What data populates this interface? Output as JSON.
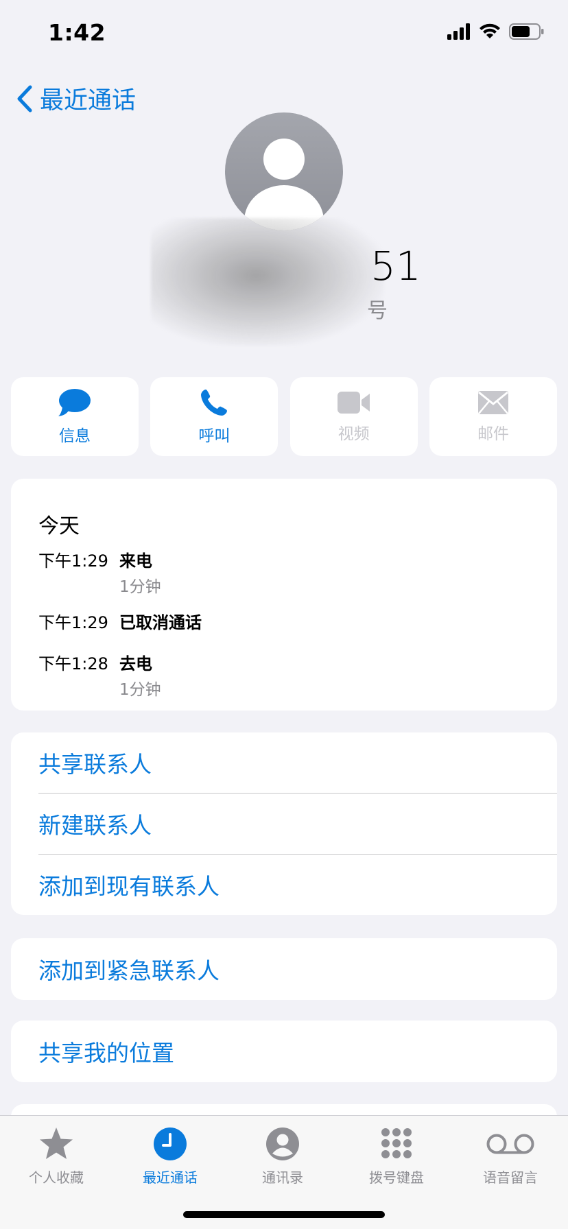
{
  "status_bar": {
    "time": "1:42"
  },
  "nav": {
    "back_label": "最近通话"
  },
  "contact": {
    "name_suffix": "51",
    "sub_suffix": "号"
  },
  "actions": [
    {
      "label": "信息",
      "icon": "message-bubble-icon",
      "enabled": true
    },
    {
      "label": "呼叫",
      "icon": "phone-icon",
      "enabled": true
    },
    {
      "label": "视频",
      "icon": "video-camera-icon",
      "enabled": false
    },
    {
      "label": "邮件",
      "icon": "envelope-icon",
      "enabled": false
    }
  ],
  "recents": {
    "title": "今天",
    "calls": [
      {
        "time": "下午1:29",
        "type": "来电",
        "duration": "1分钟"
      },
      {
        "time": "下午1:29",
        "type": "已取消通话",
        "duration": ""
      },
      {
        "time": "下午1:28",
        "type": "去电",
        "duration": "1分钟"
      }
    ]
  },
  "menu": {
    "share_contact": "共享联系人",
    "new_contact": "新建联系人",
    "add_to_existing": "添加到现有联系人",
    "add_emergency": "添加到紧急联系人",
    "share_location": "共享我的位置"
  },
  "tabs": [
    {
      "label": "个人收藏",
      "icon": "star-icon",
      "active": false
    },
    {
      "label": "最近通话",
      "icon": "clock-icon",
      "active": true
    },
    {
      "label": "通讯录",
      "icon": "person-circle-icon",
      "active": false
    },
    {
      "label": "拨号键盘",
      "icon": "keypad-icon",
      "active": false
    },
    {
      "label": "语音留言",
      "icon": "voicemail-icon",
      "active": false
    }
  ],
  "colors": {
    "accent": "#0a7bdc",
    "disabled": "#c7c7cc",
    "background": "#f2f2f7",
    "secondary_text": "#8a8a8e"
  }
}
